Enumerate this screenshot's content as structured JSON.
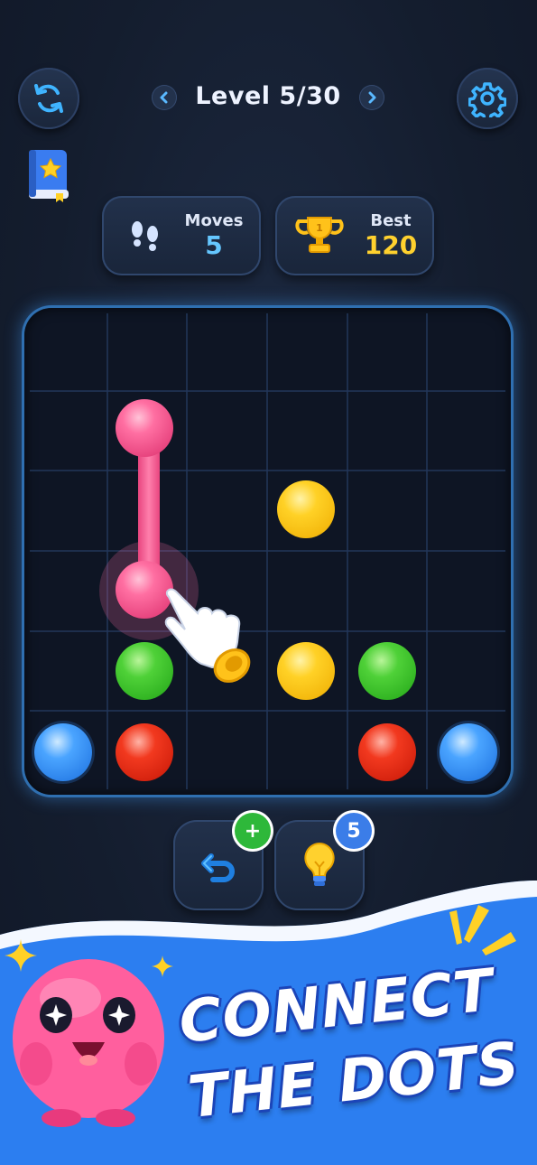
{
  "header": {
    "level_text": "Level 5/30",
    "restart_icon": "restart-icon",
    "settings_icon": "gear-icon"
  },
  "stats": {
    "moves_label": "Moves",
    "moves_value": "5",
    "best_label": "Best",
    "best_value": "120"
  },
  "board": {
    "rows": 6,
    "cols": 6,
    "dots": [
      {
        "color": "pink",
        "row": 1,
        "col": 1
      },
      {
        "color": "yellow",
        "row": 2,
        "col": 3
      },
      {
        "color": "pink",
        "row": 3,
        "col": 1
      },
      {
        "color": "green",
        "row": 4,
        "col": 1
      },
      {
        "color": "yellow",
        "row": 4,
        "col": 3
      },
      {
        "color": "green",
        "row": 4,
        "col": 4
      },
      {
        "color": "blue",
        "row": 5,
        "col": 0
      },
      {
        "color": "red",
        "row": 5,
        "col": 1
      },
      {
        "color": "red",
        "row": 5,
        "col": 4
      },
      {
        "color": "blue",
        "row": 5,
        "col": 5
      }
    ],
    "path": {
      "color": "pink",
      "from": [
        1,
        1
      ],
      "to": [
        3,
        1
      ]
    }
  },
  "tools": {
    "undo_badge": "+",
    "hint_count": "5"
  },
  "promo": {
    "line1": "CONNECT",
    "line2": "THE DOTS"
  },
  "colors": {
    "accent": "#2f6fb0",
    "pink": "#ff6fa2",
    "yellow": "#ffd126",
    "green": "#4fd138",
    "red": "#f2391f",
    "blue": "#4aa4ff",
    "banner": "#2c7ef0"
  }
}
